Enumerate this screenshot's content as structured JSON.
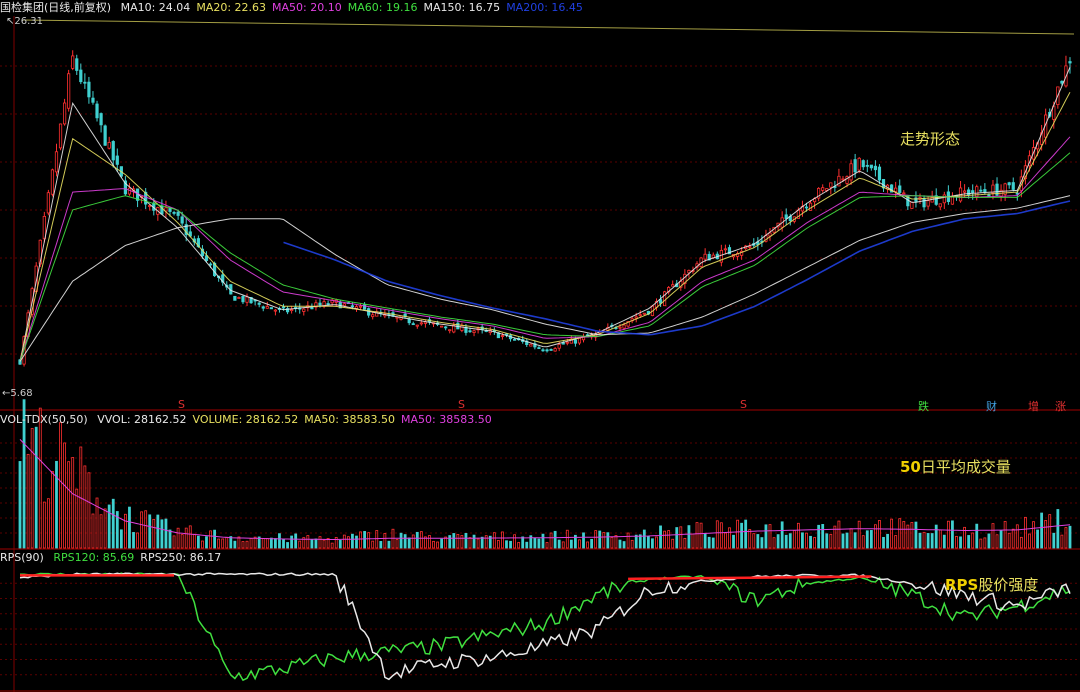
{
  "price_panel": {
    "title": "国检集团(日线,前复权)",
    "indicators": [
      {
        "label": "MA10: 24.04",
        "color": "#e8e8e8"
      },
      {
        "label": "MA20: 22.63",
        "color": "#e8e060"
      },
      {
        "label": "MA50: 20.10",
        "color": "#e040e0"
      },
      {
        "label": "MA60: 19.16",
        "color": "#40e040"
      },
      {
        "label": "MA150: 16.75",
        "color": "#e8e8e8"
      },
      {
        "label": "MA200: 16.45",
        "color": "#2040e0"
      }
    ],
    "high_label": "26.31",
    "low_label": "5.68",
    "annotation": "走势形态",
    "markers": [
      {
        "text": "S",
        "color": "#e03030"
      },
      {
        "text": "S",
        "color": "#e03030"
      },
      {
        "text": "S",
        "color": "#e03030"
      },
      {
        "text": "跌",
        "color": "#40e040"
      },
      {
        "text": "财",
        "color": "#40a0e0"
      },
      {
        "text": "增",
        "color": "#e03030"
      },
      {
        "text": "涨",
        "color": "#e03030"
      }
    ]
  },
  "volume_panel": {
    "title": "VOL-TDX(50,50)",
    "indicators": [
      {
        "label": "VVOL: 28162.52",
        "color": "#e8e8e8"
      },
      {
        "label": "VOLUME: 28162.52",
        "color": "#e8e060"
      },
      {
        "label": "MA50: 38583.50",
        "color": "#e8e060"
      },
      {
        "label": "MA50: 38583.50",
        "color": "#e040e0"
      }
    ],
    "annotation_num": "50",
    "annotation": "日平均成交量"
  },
  "rps_panel": {
    "title": "RPS(90)",
    "indicators": [
      {
        "label": "RPS120: 85.69",
        "color": "#40e040"
      },
      {
        "label": "RPS250: 86.17",
        "color": "#e8e8e8"
      }
    ],
    "annotation_en": "RPS",
    "annotation": "股价强度"
  },
  "chart_data": [
    {
      "type": "candlestick",
      "title": "国检集团(日线,前复权)",
      "ylim": [
        5.68,
        26.31
      ],
      "x": [
        0,
        5,
        10,
        15,
        20,
        25,
        30,
        35,
        40,
        45,
        50,
        55,
        60,
        65,
        70,
        75,
        80,
        85,
        90,
        95,
        100
      ],
      "close": [
        7.5,
        24.5,
        17.2,
        15.5,
        11.2,
        10.3,
        10.8,
        10.0,
        9.5,
        9.1,
        8.2,
        9.0,
        10.4,
        13.3,
        14.0,
        16.5,
        18.6,
        16.3,
        17.0,
        17.2,
        24.5
      ],
      "series": [
        {
          "name": "MA10",
          "values": [
            7.5,
            22.0,
            17.5,
            15.0,
            11.5,
            10.4,
            10.7,
            10.1,
            9.6,
            9.2,
            8.3,
            9.1,
            10.5,
            13.1,
            14.1,
            16.4,
            18.2,
            16.4,
            16.9,
            17.1,
            24.0
          ]
        },
        {
          "name": "MA20",
          "values": [
            7.5,
            20.0,
            18.0,
            15.3,
            12.0,
            10.6,
            10.6,
            10.2,
            9.7,
            9.3,
            8.5,
            9.0,
            10.2,
            12.8,
            13.9,
            16.0,
            17.8,
            16.6,
            16.8,
            17.0,
            22.6
          ]
        },
        {
          "name": "MA50",
          "values": [
            7.5,
            17.0,
            17.2,
            16.0,
            13.2,
            11.4,
            10.9,
            10.4,
            9.9,
            9.5,
            8.8,
            8.9,
            9.7,
            12.0,
            13.2,
            15.3,
            17.0,
            16.8,
            16.7,
            16.8,
            20.1
          ]
        },
        {
          "name": "MA60",
          "values": [
            7.5,
            16.0,
            16.8,
            16.0,
            13.6,
            11.8,
            11.0,
            10.5,
            10.0,
            9.6,
            9.0,
            8.9,
            9.5,
            11.7,
            12.9,
            15.0,
            16.7,
            16.8,
            16.7,
            16.7,
            19.2
          ]
        },
        {
          "name": "MA150",
          "values": [
            7.5,
            12.0,
            14.0,
            15.0,
            15.5,
            15.5,
            13.5,
            11.8,
            11.0,
            10.4,
            9.6,
            9.0,
            9.1,
            10.0,
            11.3,
            12.8,
            14.3,
            15.3,
            15.8,
            16.1,
            16.8
          ]
        },
        {
          "name": "MA200",
          "values": [
            null,
            null,
            null,
            null,
            null,
            14.2,
            13.2,
            12.0,
            11.2,
            10.5,
            9.9,
            9.2,
            9.0,
            9.5,
            10.6,
            12.1,
            13.7,
            14.8,
            15.5,
            15.8,
            16.5
          ]
        }
      ]
    },
    {
      "type": "bar",
      "title": "VOL-TDX(50,50)",
      "x": [
        0,
        5,
        10,
        15,
        20,
        25,
        30,
        35,
        40,
        45,
        50,
        55,
        60,
        65,
        70,
        75,
        80,
        85,
        90,
        95,
        100
      ],
      "values": [
        180000,
        120000,
        50000,
        25000,
        18000,
        15000,
        14000,
        22000,
        16000,
        17000,
        18000,
        19000,
        22000,
        28000,
        30000,
        32000,
        35000,
        30000,
        28000,
        30000,
        45000
      ],
      "series": [
        {
          "name": "MA50",
          "values": [
            180000,
            90000,
            45000,
            25000,
            17000,
            15000,
            14000,
            16000,
            16000,
            16500,
            17000,
            18000,
            20000,
            24000,
            28000,
            30000,
            32000,
            31000,
            29000,
            30000,
            38583.5
          ]
        }
      ]
    },
    {
      "type": "line",
      "title": "RPS(90)",
      "ylim": [
        0,
        100
      ],
      "x": [
        0,
        5,
        10,
        15,
        20,
        25,
        30,
        35,
        40,
        45,
        50,
        55,
        60,
        65,
        70,
        75,
        80,
        85,
        90,
        95,
        100
      ],
      "series": [
        {
          "name": "RPS120",
          "values": [
            98,
            98,
            98,
            98,
            8,
            15,
            25,
            30,
            35,
            45,
            55,
            80,
            94,
            96,
            75,
            90,
            95,
            80,
            60,
            70,
            85.69
          ]
        },
        {
          "name": "RPS250",
          "values": [
            95,
            98,
            98,
            98,
            98,
            98,
            98,
            10,
            20,
            25,
            35,
            50,
            85,
            92,
            96,
            97,
            97,
            90,
            80,
            70,
            86.17
          ]
        }
      ]
    }
  ]
}
